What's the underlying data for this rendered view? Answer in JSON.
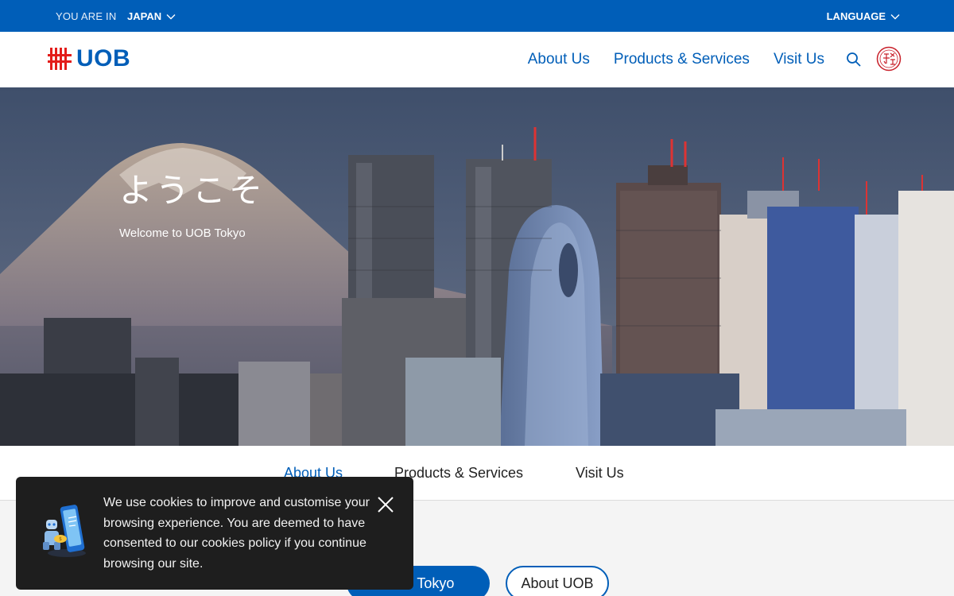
{
  "topbar": {
    "location_label": "YOU ARE IN",
    "location_value": "JAPAN",
    "language_label": "LANGUAGE"
  },
  "header": {
    "logo_text": "UOB",
    "nav": [
      "About Us",
      "Products & Services",
      "Visit Us"
    ]
  },
  "hero": {
    "title": "ようこそ",
    "subtitle": "Welcome to UOB Tokyo"
  },
  "subnav": {
    "items": [
      "About Us",
      "Products & Services",
      "Visit Us"
    ],
    "active": "About Us"
  },
  "content": {
    "pill_primary": "UOB Tokyo",
    "pill_secondary": "About UOB"
  },
  "cookie": {
    "message": "We use cookies to improve and customise your browsing experience. You are deemed to have consented to our cookies policy if you continue browsing our site."
  },
  "colors": {
    "brand_blue": "#005eb8",
    "brand_red": "#e31d1a",
    "cookie_bg": "#1e1e1e"
  },
  "icons": [
    "chevron-down-icon",
    "search-icon",
    "japan-seal-icon",
    "close-icon",
    "phone-robot-illustration",
    "uob-logo-mark"
  ]
}
